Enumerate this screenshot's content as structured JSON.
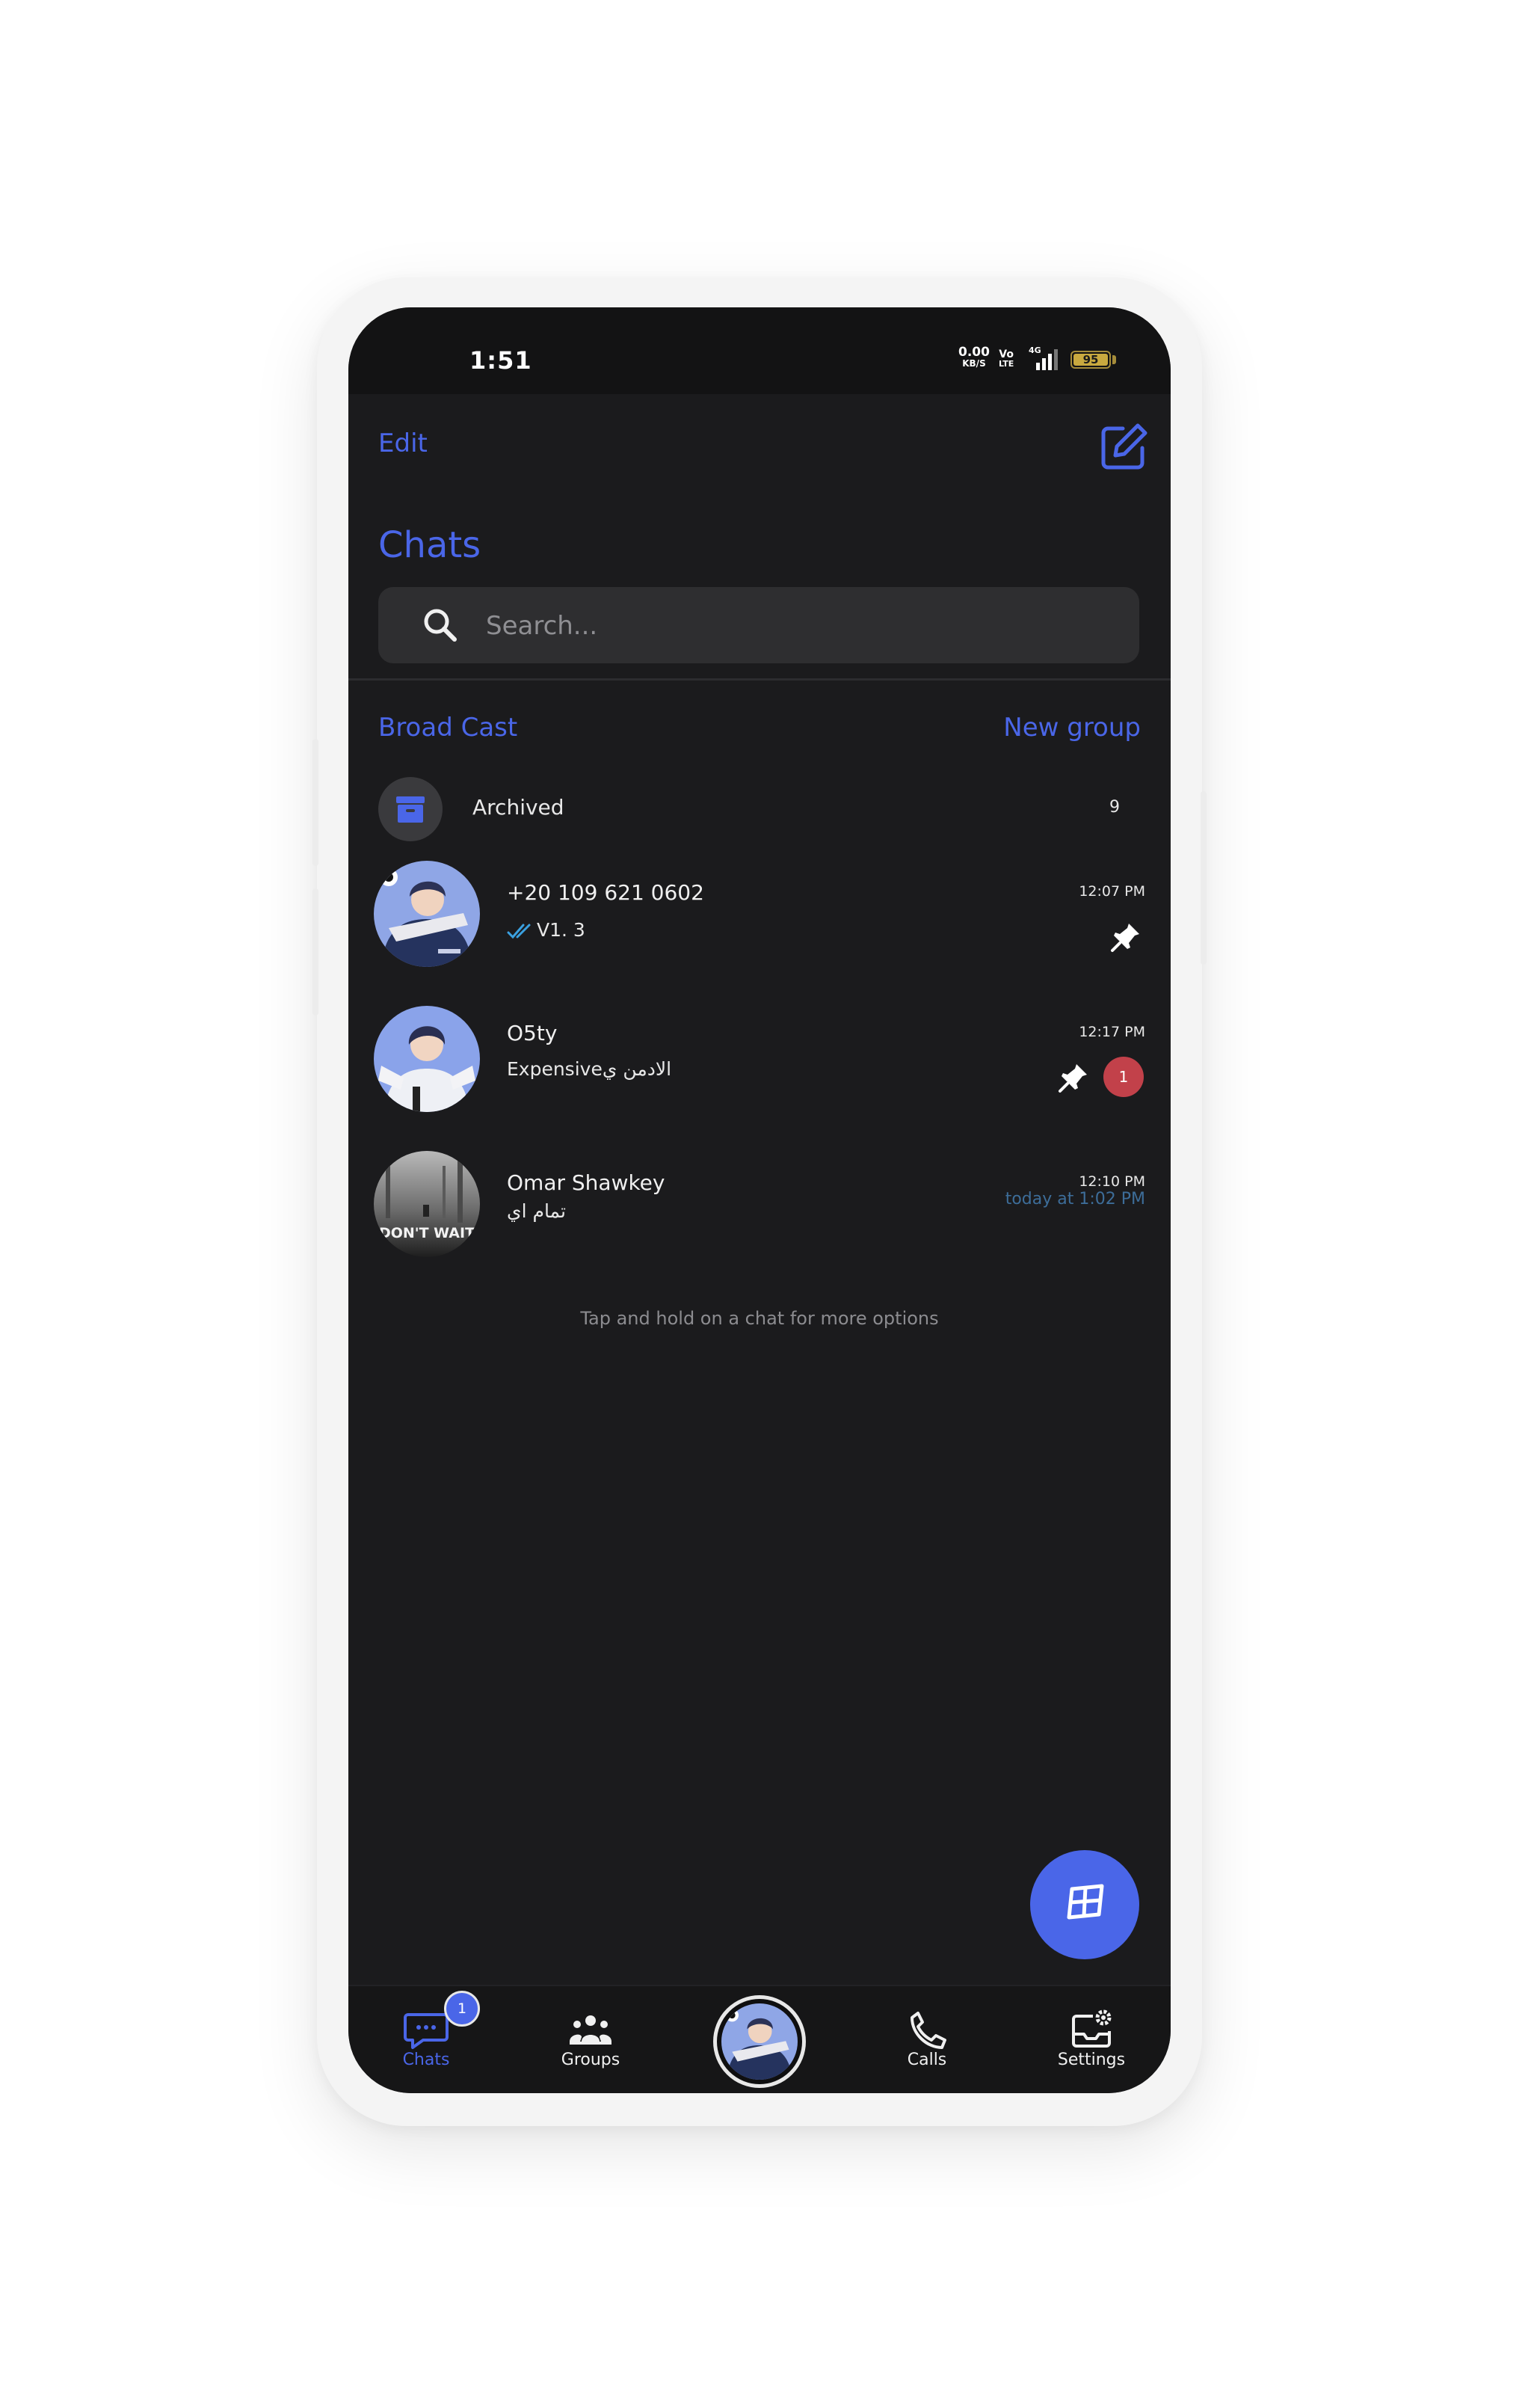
{
  "status_bar": {
    "time": "1:51",
    "net_speed": "0.00",
    "net_unit": "KB/S",
    "volte_top": "Vo",
    "volte_bottom": "LTE",
    "network": "4G",
    "battery": "95"
  },
  "header": {
    "edit_label": "Edit",
    "compose_icon": "compose-icon",
    "title": "Chats"
  },
  "search": {
    "placeholder": "Search..."
  },
  "actions": {
    "broadcast_label": "Broad Cast",
    "new_group_label": "New group"
  },
  "archived": {
    "label": "Archived",
    "count": "9"
  },
  "chats": [
    {
      "name": "+20 109 621 0602",
      "preview": "V1. 3",
      "time": "12:07 PM",
      "pinned": true,
      "read_status": "double-check"
    },
    {
      "name": "O5ty",
      "preview": "Expensiveالادمن ي",
      "time": "12:17 PM",
      "pinned": true,
      "unread": "1"
    },
    {
      "name": "Omar Shawkey",
      "preview": "تمام اي",
      "time": "12:10 PM",
      "time_sub": "today at 1:02 PM",
      "avatar_text": "DON'T WAIT"
    }
  ],
  "hint": "Tap and hold on a chat for more options",
  "fab_icon": "layers-icon",
  "bottom_nav": {
    "items": [
      {
        "label": "Chats",
        "icon": "chat-icon",
        "active": true,
        "badge": "1"
      },
      {
        "label": "Groups",
        "icon": "groups-icon"
      },
      {
        "label": "Calls",
        "icon": "phone-icon"
      },
      {
        "label": "Settings",
        "icon": "settings-icon"
      }
    ]
  },
  "colors": {
    "accent": "#4a66e8",
    "background": "#1b1b1d",
    "badge_red": "#c2414a",
    "read_tick": "#3aa0e0"
  }
}
